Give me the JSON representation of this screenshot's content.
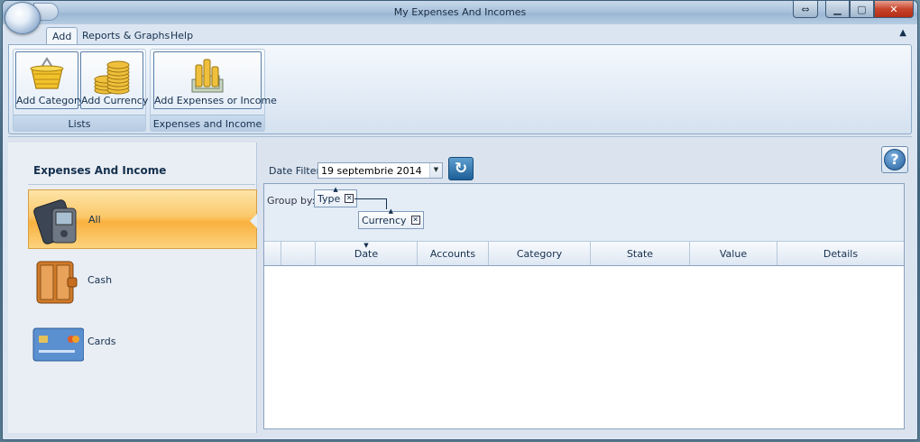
{
  "window": {
    "title": "My Expenses And Incomes"
  },
  "ribbon": {
    "tabs": [
      {
        "label": "Add",
        "active": true
      },
      {
        "label": "Reports & Graphs",
        "active": false
      },
      {
        "label": "Help",
        "active": false
      }
    ],
    "groups": {
      "lists": {
        "label": "Lists",
        "buttons": {
          "add_category": "Add Category",
          "add_currency": "Add Currency"
        }
      },
      "expenses": {
        "label": "Expenses and Income",
        "buttons": {
          "add_expenses": "Add Expenses or Income"
        }
      }
    }
  },
  "left_pane": {
    "title": "Expenses And Income",
    "items": [
      {
        "label": "All",
        "icon": "wallet-pda-icon",
        "selected": true
      },
      {
        "label": "Cash",
        "icon": "wallet-icon",
        "selected": false
      },
      {
        "label": "Cards",
        "icon": "credit-card-icon",
        "selected": false
      }
    ]
  },
  "filter": {
    "label": "Date Filter",
    "value": "19 septembrie 2014"
  },
  "groupby": {
    "label": "Group by:",
    "chips": [
      "Type",
      "Currency"
    ]
  },
  "grid": {
    "columns": [
      "",
      "",
      "Date",
      "Accounts",
      "Category",
      "State",
      "Value",
      "Details"
    ],
    "rows": []
  },
  "colors": {
    "selected_item": "#f9b13f",
    "accent": "#1c5f97"
  }
}
